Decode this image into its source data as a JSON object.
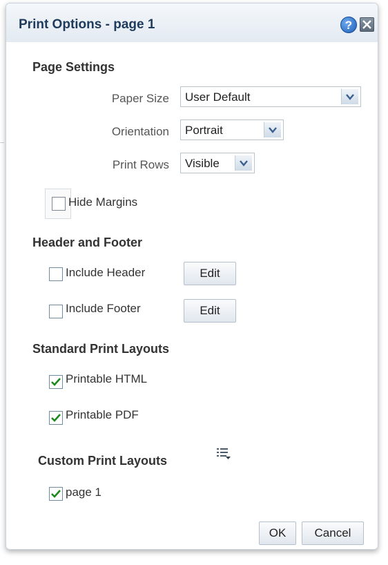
{
  "dialog": {
    "title": "Print Options - page 1",
    "help_icon": "help-icon",
    "close_icon": "close-icon"
  },
  "page_settings": {
    "heading": "Page Settings",
    "paper_size": {
      "label": "Paper Size",
      "value": "User Default"
    },
    "orientation": {
      "label": "Orientation",
      "value": "Portrait"
    },
    "print_rows": {
      "label": "Print Rows",
      "value": "Visible"
    },
    "hide_margins": {
      "label": "Hide Margins",
      "checked": false
    }
  },
  "header_footer": {
    "heading": "Header and Footer",
    "include_header": {
      "label": "Include Header",
      "checked": false,
      "edit_label": "Edit"
    },
    "include_footer": {
      "label": "Include Footer",
      "checked": false,
      "edit_label": "Edit"
    }
  },
  "standard_layouts": {
    "heading": "Standard Print Layouts",
    "items": [
      {
        "label": "Printable HTML",
        "checked": true
      },
      {
        "label": "Printable PDF",
        "checked": true
      }
    ]
  },
  "custom_layouts": {
    "heading": "Custom Print Layouts",
    "menu_icon": "list-menu-icon",
    "items": [
      {
        "label": "page 1",
        "checked": true
      }
    ]
  },
  "buttons": {
    "ok_label": "OK",
    "cancel_label": "Cancel"
  },
  "colors": {
    "title": "#1f3b5b",
    "check_mark": "#1a8a1a",
    "help_blue": "#1d5fb8"
  }
}
